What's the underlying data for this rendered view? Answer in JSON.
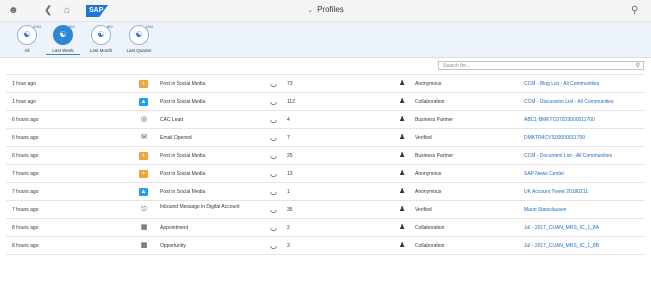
{
  "shell": {
    "title": "Profiles",
    "icons": {
      "user": "user-icon",
      "back": "back-icon",
      "home": "home-icon",
      "search": "search-icon"
    },
    "logo_text": "SAP"
  },
  "filters": [
    {
      "label": "All",
      "count": "20M",
      "icon": "all-icon",
      "selected": false
    },
    {
      "label": "Last Week",
      "count": "6M",
      "icon": "week-icon",
      "selected": true
    },
    {
      "label": "Last Month",
      "count": "8M",
      "icon": "month-icon",
      "selected": false
    },
    {
      "label": "Last Quarter",
      "count": "13M",
      "icon": "quarter-icon",
      "selected": false
    }
  ],
  "search": {
    "placeholder": "Search for..."
  },
  "rows": [
    {
      "time": "1 hour ago",
      "channel_icon": "rss",
      "channel": "Post in Social Media",
      "score": "73",
      "profile_icon": "anonymous-user-icon",
      "profile": "Anonymous",
      "link": "CCM - Blog List - All Communities"
    },
    {
      "time": "1 hour ago",
      "channel_icon": "twitter",
      "channel": "Post in Social Media",
      "score": "112",
      "profile_icon": "collaboration-user-icon",
      "profile": "Collaboration",
      "link": "CCM - Discussion List - All Communities"
    },
    {
      "time": "6 hours ago",
      "channel_icon": "lead",
      "channel": "CAC Lead",
      "score": "4",
      "profile_icon": "business-user-icon",
      "profile": "Business Partner",
      "link": "ABC1-BMKTC07029500011700"
    },
    {
      "time": "6 hours ago",
      "channel_icon": "email",
      "channel": "Email Opened",
      "score": "7",
      "profile_icon": "verified-user-icon",
      "profile": "Verified",
      "link": "DMKTR4CVS00000011700"
    },
    {
      "time": "6 hours ago",
      "channel_icon": "rss",
      "channel": "Post in Social Media",
      "score": "25",
      "profile_icon": "business-user-icon",
      "profile": "Business Partner",
      "link": "CCM - Document List - All Communities"
    },
    {
      "time": "7 hours ago",
      "channel_icon": "rss",
      "channel": "Post in Social Media",
      "score": "13",
      "profile_icon": "anonymous-user-icon",
      "profile": "Anonymous",
      "link": "SAP News Center"
    },
    {
      "time": "7 hours ago",
      "channel_icon": "twitter",
      "channel": "Post in Social Media",
      "score": "1",
      "profile_icon": "anonymous-user-icon",
      "profile": "Anonymous",
      "link": "UK Account Tweet 20180211"
    },
    {
      "time": "7 hours ago",
      "channel_icon": "inbound",
      "channel": "Inbound Message in Digital Account",
      "score": "35",
      "profile_icon": "verified-user-icon",
      "profile": "Verified",
      "link": "Mario Stanislausen"
    },
    {
      "time": "8 hours ago",
      "channel_icon": "appointment",
      "channel": "Appointment",
      "score": "2",
      "profile_icon": "collaboration-user-icon",
      "profile": "Collaboration",
      "link": "Jul - 2017_CUAN_MRS_IC_1_8A"
    },
    {
      "time": "8 hours ago",
      "channel_icon": "opportunity",
      "channel": "Opportunity",
      "score": "3",
      "profile_icon": "collaboration-user-icon",
      "profile": "Collaboration",
      "link": "Jul - 2017_CUAN_MRS_IC_1_8B"
    }
  ],
  "colors": {
    "accent": "#2f86d4",
    "link": "#1b6fc1",
    "rss": "#f0a33a",
    "twitter": "#1da1f2"
  }
}
